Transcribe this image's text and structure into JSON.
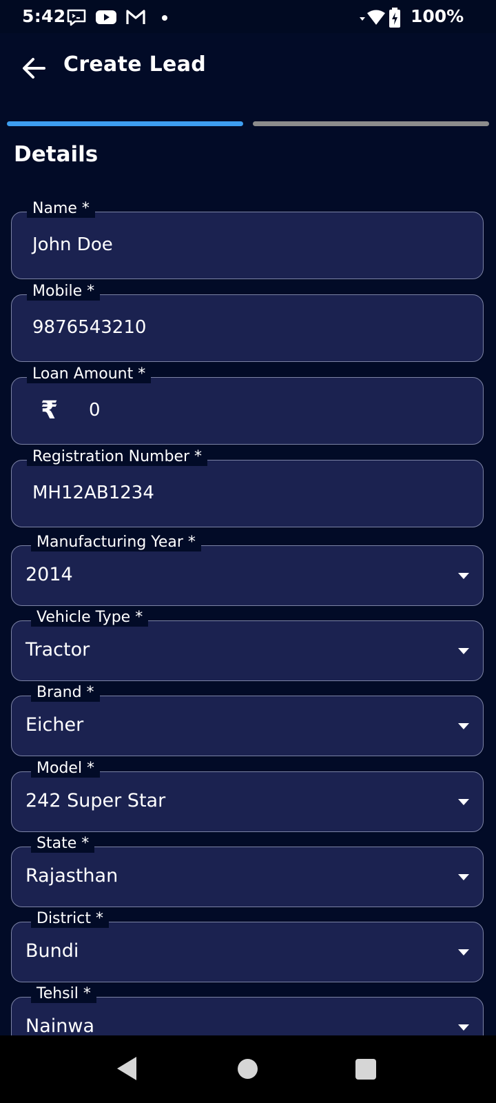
{
  "status_bar": {
    "time": "5:42",
    "battery": "100%",
    "icons": [
      "message-icon",
      "youtube-icon",
      "gmail-icon",
      "notification-dot-icon",
      "wifi-icon",
      "battery-charging-icon"
    ]
  },
  "header": {
    "title": "Create Lead",
    "back_icon": "arrow-left-icon"
  },
  "progress": {
    "steps_total": 2,
    "current_step": 1,
    "active_color": "#3e9ef0",
    "inactive_color": "#8c8c8c"
  },
  "section": {
    "title": "Details"
  },
  "fields": {
    "name": {
      "label": "Name *",
      "value": "John Doe"
    },
    "mobile": {
      "label": "Mobile *",
      "value": "9876543210"
    },
    "loan_amount": {
      "label": "Loan Amount *",
      "currency_symbol": "₹",
      "value": "0"
    },
    "registration_number": {
      "label": "Registration Number *",
      "value": "MH12AB1234"
    },
    "manufacturing_year": {
      "label": "Manufacturing Year *",
      "value": "2014"
    },
    "vehicle_type": {
      "label": "Vehicle Type *",
      "value": "Tractor"
    },
    "brand": {
      "label": "Brand *",
      "value": "Eicher"
    },
    "model": {
      "label": "Model *",
      "value": "242 Super Star"
    },
    "state": {
      "label": "State *",
      "value": "Rajasthan"
    },
    "district": {
      "label": "District *",
      "value": "Bundi"
    },
    "tehsil": {
      "label": "Tehsil *",
      "value": "Nainwa"
    }
  },
  "colors": {
    "background": "#020b27",
    "field_background": "#1b2250",
    "field_border": "#7d84a6"
  }
}
